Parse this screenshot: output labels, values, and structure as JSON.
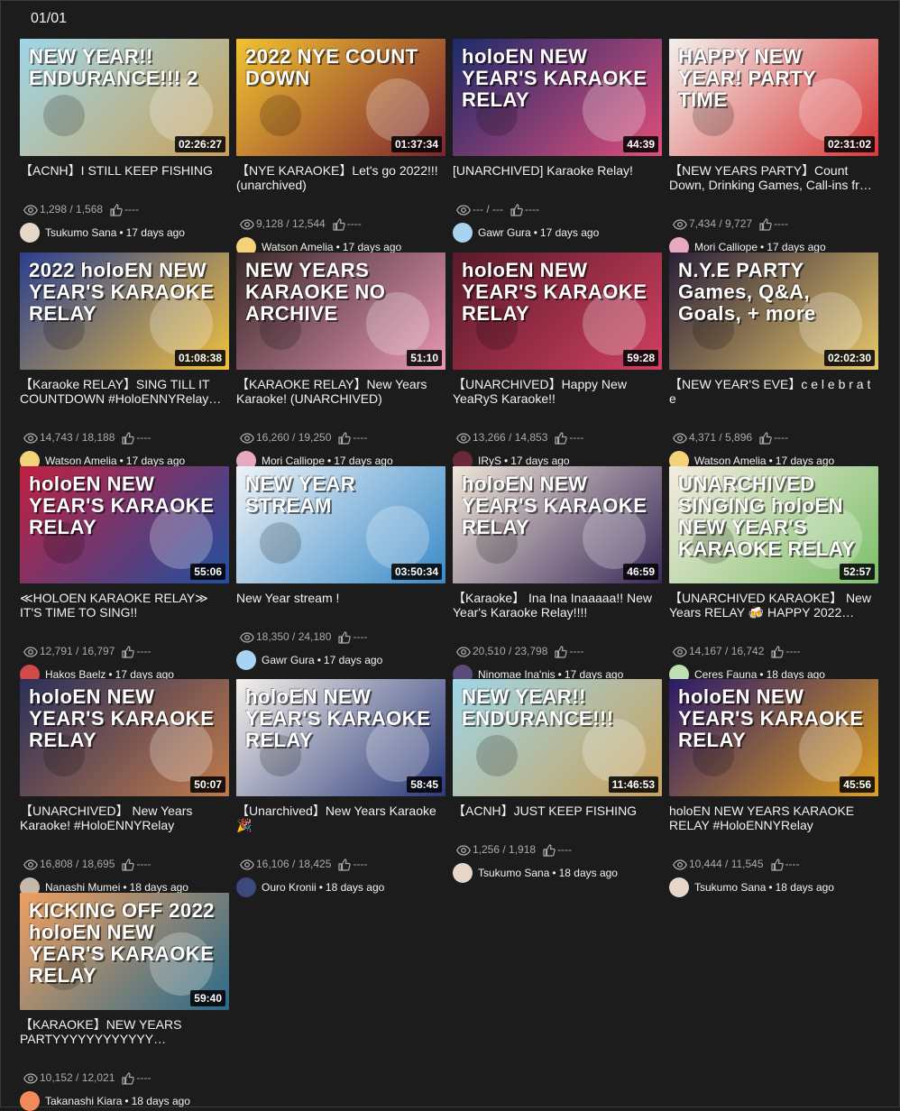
{
  "page_indicator": "01/01",
  "videos": [
    {
      "title": "【ACNH】I STILL KEEP FISHING",
      "duration": "02:26:27",
      "views": "1,298 / 1,568",
      "likes": "----",
      "channel": "Tsukumo Sana",
      "age": "17 days ago",
      "thumb_text": "NEW YEAR!! ENDURANCE!!! 2",
      "thumb_colors": [
        "#9fd6e8",
        "#c9a15a"
      ],
      "avatar_color": "#e7d7c9"
    },
    {
      "title": "【NYE KARAOKE】Let's go 2022!!! (unarchived)",
      "duration": "01:37:34",
      "views": "9,128 / 12,544",
      "likes": "----",
      "channel": "Watson Amelia",
      "age": "17 days ago",
      "thumb_text": "2022  NYE COUNT DOWN",
      "thumb_colors": [
        "#f2c230",
        "#7b2430"
      ],
      "avatar_color": "#f3d27a"
    },
    {
      "title": "[UNARCHIVED] Karaoke Relay!",
      "duration": "44:39",
      "views": "--- / ---",
      "likes": "----",
      "channel": "Gawr Gura",
      "age": "17 days ago",
      "thumb_text": "holoEN NEW YEAR'S KARAOKE RELAY",
      "thumb_colors": [
        "#1c2b6b",
        "#e04e7a"
      ],
      "avatar_color": "#a9d3f0"
    },
    {
      "title": "【NEW YEARS PARTY】Count Down, Drinking Games, Call-ins fr…",
      "duration": "02:31:02",
      "views": "7,434 / 9,727",
      "likes": "----",
      "channel": "Mori Calliope",
      "age": "17 days ago",
      "thumb_text": "HAPPY NEW YEAR!  PARTY TIME",
      "thumb_colors": [
        "#f2f0ec",
        "#d83a3a"
      ],
      "avatar_color": "#e8a9c0"
    },
    {
      "title": "【Karaoke RELAY】SING TILL IT COUNTDOWN #HoloENNYRelay…",
      "duration": "01:08:38",
      "views": "14,743 / 18,188",
      "likes": "----",
      "channel": "Watson Amelia",
      "age": "17 days ago",
      "thumb_text": "2022 holoEN NEW YEAR'S KARAOKE RELAY",
      "thumb_colors": [
        "#2a3f8f",
        "#f0c040"
      ],
      "avatar_color": "#f3d27a"
    },
    {
      "title": "【KARAOKE RELAY】New Years Karaoke! (UNARCHIVED)",
      "duration": "51:10",
      "views": "16,260 / 19,250",
      "likes": "----",
      "channel": "Mori Calliope",
      "age": "17 days ago",
      "thumb_text": "NEW YEARS KARAOKE NO ARCHIVE",
      "thumb_colors": [
        "#3a2a2a",
        "#e897b5"
      ],
      "avatar_color": "#e8a9c0"
    },
    {
      "title": "【UNARCHIVED】Happy New YeaRyS Karaoke!!",
      "duration": "59:28",
      "views": "13,266 / 14,853",
      "likes": "----",
      "channel": "IRyS",
      "age": "17 days ago",
      "thumb_text": "holoEN NEW YEAR'S KARAOKE RELAY",
      "thumb_colors": [
        "#5a1a2a",
        "#d04060"
      ],
      "avatar_color": "#6a2a3a"
    },
    {
      "title": "【NEW YEAR'S EVE】c e l e b r a t e",
      "duration": "02:02:30",
      "views": "4,371 / 5,896",
      "likes": "----",
      "channel": "Watson Amelia",
      "age": "17 days ago",
      "thumb_text": "N.Y.E PARTY  Games, Q&A, Goals, + more",
      "thumb_colors": [
        "#2a1f3a",
        "#e8c86a"
      ],
      "avatar_color": "#f3d27a"
    },
    {
      "title": "≪HOLOEN KARAOKE RELAY≫ IT'S TIME TO SING!!",
      "duration": "55:06",
      "views": "12,791 / 16,797",
      "likes": "----",
      "channel": "Hakos Baelz",
      "age": "17 days ago",
      "thumb_text": "holoEN NEW YEAR'S KARAOKE RELAY",
      "thumb_colors": [
        "#c02040",
        "#2050a0"
      ],
      "avatar_color": "#d04a4a"
    },
    {
      "title": "New Year stream !",
      "duration": "03:50:34",
      "views": "18,350 / 24,180",
      "likes": "----",
      "channel": "Gawr Gura",
      "age": "17 days ago",
      "thumb_text": "NEW YEAR STREAM",
      "thumb_colors": [
        "#eef3f6",
        "#3a8ac8"
      ],
      "avatar_color": "#a9d3f0"
    },
    {
      "title": "【Karaoke】 Ina Ina Inaaaaa!! New Year's Karaoke Relay!!!!",
      "duration": "46:59",
      "views": "20,510 / 23,798",
      "likes": "----",
      "channel": "Ninomae Ina'nis",
      "age": "17 days ago",
      "thumb_text": "holoEN NEW YEAR'S KARAOKE RELAY",
      "thumb_colors": [
        "#f0e6d8",
        "#3a2a5a"
      ],
      "avatar_color": "#5a4a7a"
    },
    {
      "title": "【UNARCHIVED KARAOKE】 New Years RELAY 🍻 HAPPY 2022…",
      "duration": "52:57",
      "views": "14,167 / 16,742",
      "likes": "----",
      "channel": "Ceres Fauna",
      "age": "18 days ago",
      "thumb_text": "UNARCHIVED SINGING holoEN NEW YEAR'S KARAOKE RELAY",
      "thumb_colors": [
        "#f4ece0",
        "#7cbf6a"
      ],
      "avatar_color": "#bde0b0"
    },
    {
      "title": "【UNARCHIVED】 New Years Karaoke! #HoloENNYRelay",
      "duration": "50:07",
      "views": "16,808 / 18,695",
      "likes": "----",
      "channel": "Nanashi Mumei",
      "age": "18 days ago",
      "thumb_text": "holoEN NEW YEAR'S KARAOKE RELAY",
      "thumb_colors": [
        "#2a2f5a",
        "#c07a4a"
      ],
      "avatar_color": "#c8b8a8"
    },
    {
      "title": "【Unarchived】New Years Karaoke 🎉",
      "duration": "58:45",
      "views": "16,106 / 18,425",
      "likes": "----",
      "channel": "Ouro Kronii",
      "age": "18 days ago",
      "thumb_text": "holoEN NEW YEAR'S KARAOKE RELAY",
      "thumb_colors": [
        "#f4f0ea",
        "#2a3a7a"
      ],
      "avatar_color": "#3a4a7a"
    },
    {
      "title": "【ACNH】JUST KEEP FISHING",
      "duration": "11:46:53",
      "views": "1,256 / 1,918",
      "likes": "----",
      "channel": "Tsukumo Sana",
      "age": "18 days ago",
      "thumb_text": "NEW YEAR!! ENDURANCE!!!",
      "thumb_colors": [
        "#9fd6e8",
        "#c9a15a"
      ],
      "avatar_color": "#e7d7c9"
    },
    {
      "title": "holoEN NEW YEARS KARAOKE RELAY #HoloENNYRelay",
      "duration": "45:56",
      "views": "10,444 / 11,545",
      "likes": "----",
      "channel": "Tsukumo Sana",
      "age": "18 days ago",
      "thumb_text": "holoEN NEW YEAR'S KARAOKE RELAY",
      "thumb_colors": [
        "#2a1a6a",
        "#e0a020"
      ],
      "avatar_color": "#e7d7c9"
    },
    {
      "title": "【KARAOKE】NEW YEARS PARTYYYYYYYYYYYY…",
      "duration": "59:40",
      "views": "10,152 / 12,021",
      "likes": "----",
      "channel": "Takanashi Kiara",
      "age": "18 days ago",
      "thumb_text": "KICKING OFF 2022 holoEN NEW YEAR'S KARAOKE RELAY",
      "thumb_colors": [
        "#f0a060",
        "#2a6a8a"
      ],
      "avatar_color": "#f08a5a"
    }
  ]
}
